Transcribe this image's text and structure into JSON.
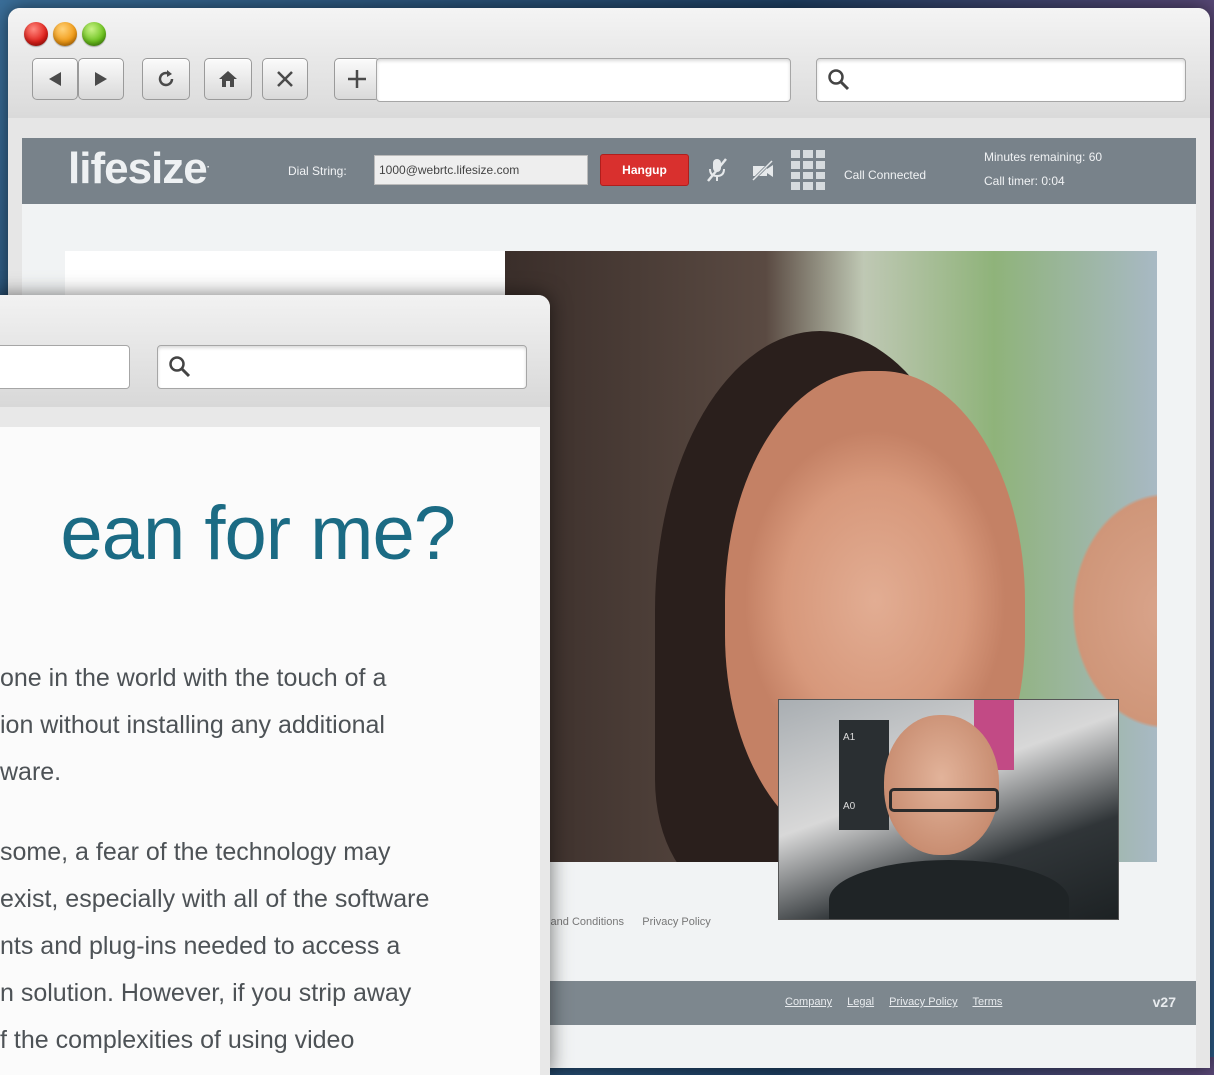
{
  "back_window": {
    "toolbar": {
      "back_icon": "triangle-left-icon",
      "forward_icon": "triangle-right-icon",
      "reload_icon": "reload-icon",
      "home_icon": "home-icon",
      "stop_icon": "close-icon",
      "new_tab_icon": "plus-icon",
      "url_value": "",
      "search_icon": "search-icon"
    },
    "lifesize": {
      "logo": "lifesize",
      "dial_label": "Dial String:",
      "dial_value": "1000@webrtc.lifesize.com",
      "hangup_label": "Hangup",
      "status": "Call Connected",
      "minutes_remaining": "Minutes remaining: 60",
      "call_timer": "Call timer: 0:04"
    },
    "pip_sign": {
      "top": "A1",
      "bottom": "A0"
    },
    "footer": {
      "links_upper": [
        "s and Conditions",
        "Privacy Policy"
      ],
      "links_lower": [
        "Company",
        "Legal",
        "Privacy Policy",
        "Terms"
      ],
      "version": "v27"
    }
  },
  "front_window": {
    "search_icon": "search-icon",
    "headline": "ean for me?",
    "paragraph1": [
      "one in the world with the touch of a",
      "ion without installing any additional",
      "ware."
    ],
    "paragraph2": [
      "some, a fear of the technology may",
      "exist, especially with all of the software",
      "nts and plug-ins needed to access a",
      "n solution. However, if you strip away",
      "f the complexities of using video"
    ]
  },
  "colors": {
    "headline": "#1b6b84",
    "header_bar": "#78828a",
    "hangup": "#d9302e"
  }
}
